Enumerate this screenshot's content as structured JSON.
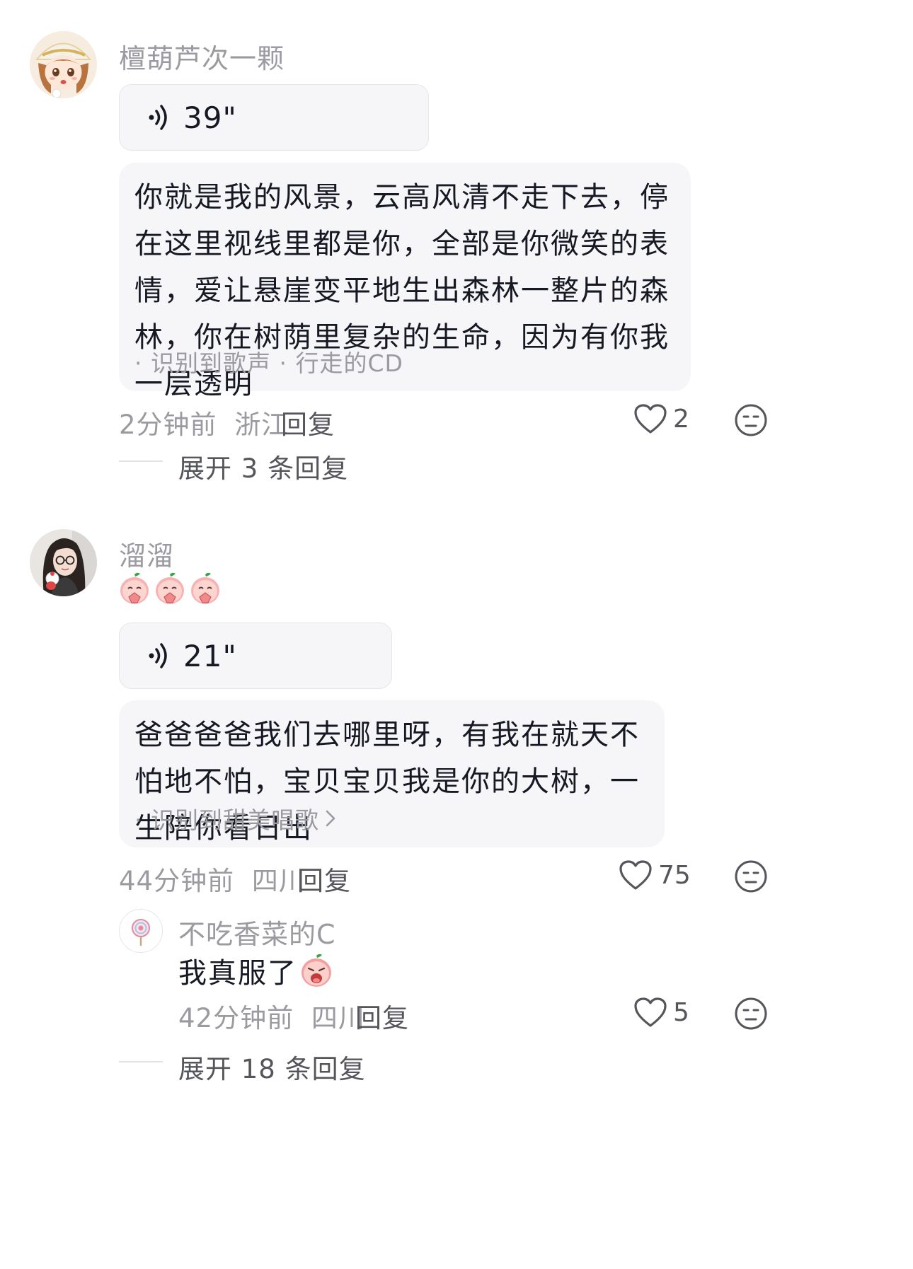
{
  "comments": [
    {
      "username": "檀葫芦次一颗",
      "voice_duration": "39\"",
      "lyrics": "你就是我的风景，云高风清不走下去，停在这里视线里都是你，全部是你微笑的表情，爱让悬崖变平地生出森林一整片的森林，你在树荫里复杂的生命，因为有你我一层透明",
      "lyric_tag": "· 识别到歌声 · 行走的CD",
      "time": "2分钟前",
      "location": "浙江",
      "reply_label": "回复",
      "likes": "2",
      "expand_label": "展开 3 条回复"
    },
    {
      "username": "溜溜",
      "emoji": "peach-praying-emoji ×3",
      "voice_duration": "21\"",
      "lyrics": "爸爸爸爸我们去哪里呀，有我在就天不怕地不怕，宝贝宝贝我是你的大树，一生陪你看日出",
      "lyric_tag": "· 识别到甜美唱歌",
      "time": "44分钟前",
      "location": "四川",
      "reply_label": "回复",
      "likes": "75",
      "reply": {
        "username": "不吃香菜的C",
        "text": "我真服了",
        "time": "42分钟前",
        "location": "四川",
        "reply_label": "回复",
        "likes": "5"
      },
      "expand_label": "展开 18 条回复"
    }
  ],
  "colors": {
    "background": "#ffffff",
    "text": "#161823",
    "muted": "#9a9aa0",
    "card": "#f6f6f8"
  }
}
